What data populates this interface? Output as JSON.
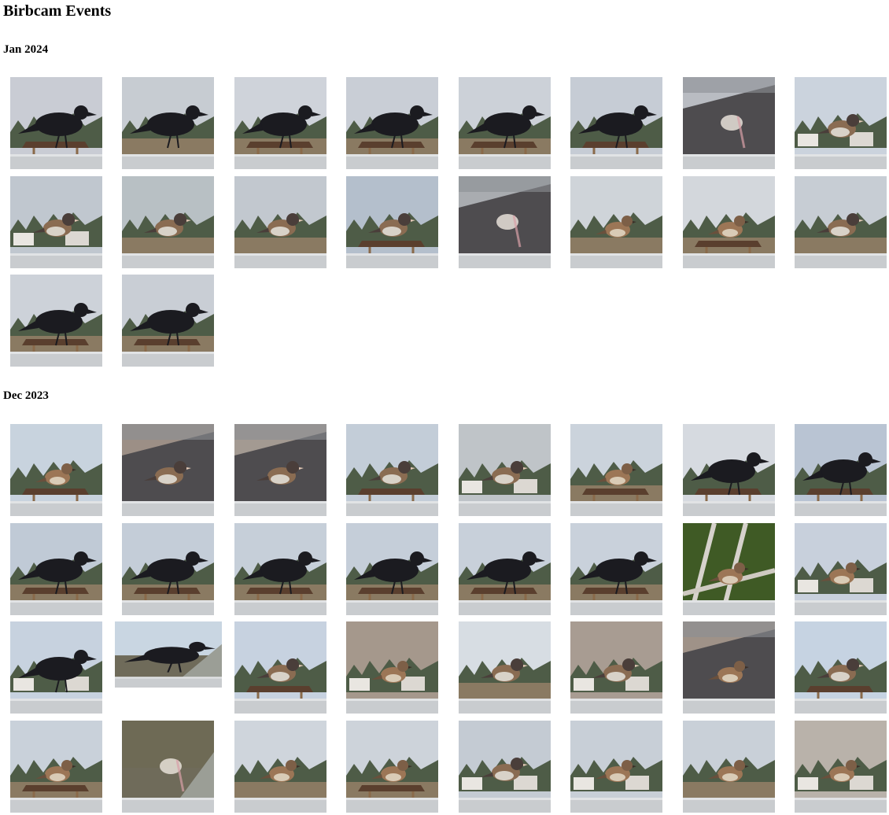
{
  "page": {
    "title": "Birbcam Events"
  },
  "months": [
    {
      "label": "Jan 2024",
      "events": [
        {
          "bird": "crow",
          "scene": "sky-feeder",
          "sky": "#c9ccd4"
        },
        {
          "bird": "crow",
          "scene": "grass",
          "sky": "#c7ccd2"
        },
        {
          "bird": "crow",
          "scene": "feeder-trees",
          "sky": "#cfd3da"
        },
        {
          "bird": "crow",
          "scene": "feeder-trees",
          "sky": "#c9ced6"
        },
        {
          "bird": "crow",
          "scene": "feeder-trees",
          "sky": "#ccd1d8"
        },
        {
          "bird": "crow",
          "scene": "sky-feeder",
          "sky": "#c6ccd5"
        },
        {
          "bird": "blur",
          "scene": "roof",
          "sky": "#b9bcc2"
        },
        {
          "bird": "junco",
          "scene": "houses-rail",
          "sky": "#cbd3dd"
        },
        {
          "bird": "junco",
          "scene": "houses-rail",
          "sky": "#c0c7cf"
        },
        {
          "bird": "junco",
          "scene": "trees-rail",
          "sky": "#b8c0c4"
        },
        {
          "bird": "junco",
          "scene": "trees-rail",
          "sky": "#c2c8cf"
        },
        {
          "bird": "junco",
          "scene": "sky-feeder",
          "sky": "#b4bfcc"
        },
        {
          "bird": "blur",
          "scene": "roof",
          "sky": "#a9acb0"
        },
        {
          "bird": "sparrow",
          "scene": "grass",
          "sky": "#cfd4d9"
        },
        {
          "bird": "sparrow",
          "scene": "feeder-trees",
          "sky": "#d3d7dc"
        },
        {
          "bird": "junco",
          "scene": "trees-rail",
          "sky": "#c7cdd4"
        },
        {
          "bird": "crow",
          "scene": "feeder-trees",
          "sky": "#cdd2d9"
        },
        {
          "bird": "crow",
          "scene": "feeder-trees",
          "sky": "#c9ced5"
        }
      ]
    },
    {
      "label": "Dec 2023",
      "events": [
        {
          "bird": "sparrow",
          "scene": "sky-feeder",
          "sky": "#c8d3de"
        },
        {
          "bird": "junco",
          "scene": "roof-rail",
          "sky": "#9c8f86"
        },
        {
          "bird": "junco",
          "scene": "roof-rail",
          "sky": "#a39a92"
        },
        {
          "bird": "junco",
          "scene": "sky-feeder",
          "sky": "#c3cdd8"
        },
        {
          "bird": "junco",
          "scene": "houses-rail",
          "sky": "#bfc4c8"
        },
        {
          "bird": "sparrow",
          "scene": "feeder-trees",
          "sky": "#cbd3dc"
        },
        {
          "bird": "crow",
          "scene": "sky-feeder",
          "sky": "#d6dae0"
        },
        {
          "bird": "crow",
          "scene": "sky-feeder",
          "sky": "#b9c4d3"
        },
        {
          "bird": "crow",
          "scene": "feeder-trees",
          "sky": "#c0cad6"
        },
        {
          "bird": "crow",
          "scene": "feeder-trees",
          "sky": "#c4cdd8"
        },
        {
          "bird": "crow",
          "scene": "feeder-trees",
          "sky": "#c6cfd9"
        },
        {
          "bird": "crow",
          "scene": "feeder-trees",
          "sky": "#c5ced9"
        },
        {
          "bird": "crow",
          "scene": "feeder-trees",
          "sky": "#c8d0da"
        },
        {
          "bird": "crow",
          "scene": "feeder-trees",
          "sky": "#c9d1db"
        },
        {
          "bird": "sparrow",
          "scene": "leaves",
          "sky": "#4b6b2e"
        },
        {
          "bird": "sparrow",
          "scene": "houses-rail",
          "sky": "#c8d0dc"
        },
        {
          "bird": "crow",
          "scene": "houses-rail",
          "sky": "#c7d2df"
        },
        {
          "bird": "crow",
          "scene": "closeup",
          "sky": "#c9d6e2",
          "wide": true
        },
        {
          "bird": "junco",
          "scene": "sky-feeder",
          "sky": "#c7d2e0"
        },
        {
          "bird": "sparrow",
          "scene": "houses-rail",
          "sky": "#a5988c"
        },
        {
          "bird": "junco",
          "scene": "trees-rail",
          "sky": "#d7dde3"
        },
        {
          "bird": "junco",
          "scene": "houses-rail",
          "sky": "#a89c92"
        },
        {
          "bird": "sparrow",
          "scene": "roof-rail",
          "sky": "#9f9288"
        },
        {
          "bird": "junco",
          "scene": "sky-feeder",
          "sky": "#c6d3e2"
        },
        {
          "bird": "sparrow",
          "scene": "feeder-trees",
          "sky": "#c9d1da"
        },
        {
          "bird": "blur",
          "scene": "closeup-rail",
          "sky": "#6e6a55"
        },
        {
          "bird": "sparrow",
          "scene": "trees-rail",
          "sky": "#cfd5dc"
        },
        {
          "bird": "sparrow",
          "scene": "feeder-trees",
          "sky": "#cdd3da"
        },
        {
          "bird": "junco",
          "scene": "houses-rail",
          "sky": "#c4cbd3"
        },
        {
          "bird": "sparrow",
          "scene": "houses-rail",
          "sky": "#c8cfd7"
        },
        {
          "bird": "sparrow",
          "scene": "trees-rail",
          "sky": "#c9d0d8"
        },
        {
          "bird": "sparrow",
          "scene": "houses-rail",
          "sky": "#b9b2aa"
        }
      ]
    }
  ]
}
